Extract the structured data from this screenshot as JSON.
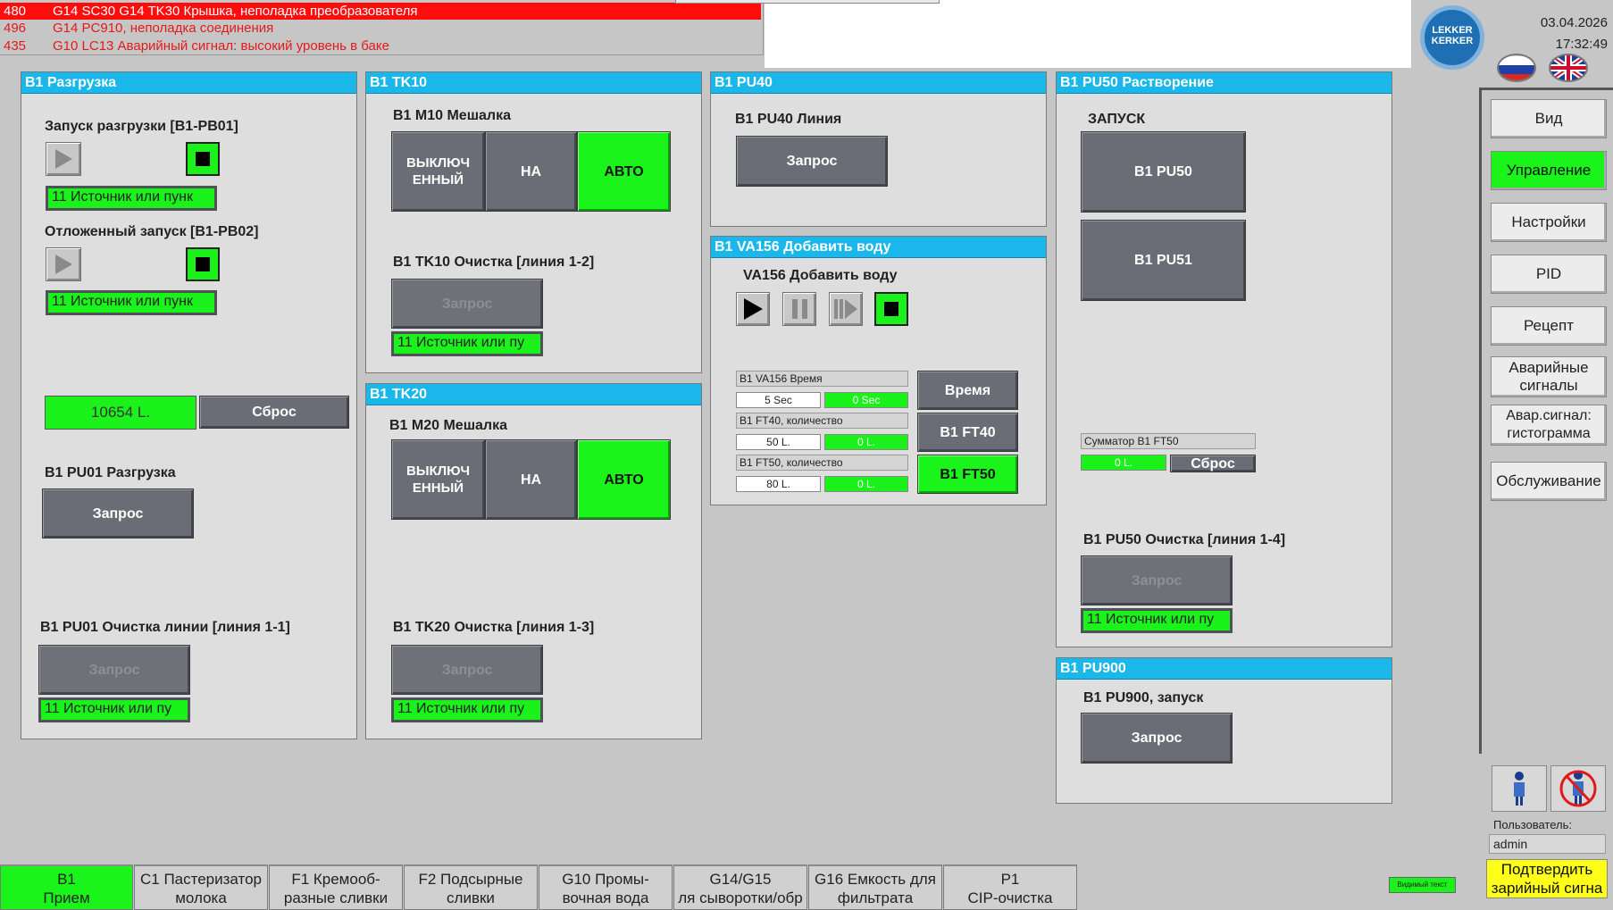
{
  "alarms": [
    {
      "num": "480",
      "text": "G14 SC30 G14 TK30 Крышка, неполадка преобразователя"
    },
    {
      "num": "496",
      "text": "G14 PC910, неполадка соединения"
    },
    {
      "num": "435",
      "text": "G10 LC13 Аварийный сигнал: высокий уровень в баке"
    }
  ],
  "header": {
    "logo_line1": "LEKKER",
    "logo_line2": "KERKER",
    "date": "03.04.2026",
    "time": "17:32:49"
  },
  "unload": {
    "title": "B1 Разгрузка",
    "start_label": "Запуск разгрузки [B1-PB01]",
    "start_status": "11 Источник или пунк",
    "delayed_label": "Отложенный запуск [B1-PB02]",
    "delayed_status": "11 Источник или пунк",
    "counter": "10654 L.",
    "reset": "Сброс",
    "pu01_label": "B1 PU01 Разгрузка",
    "pu01_btn": "Запрос",
    "clean_label": "B1 PU01 Очистка линии [линия 1-1]",
    "clean_btn": "Запрос",
    "clean_status": "11 Источник или пу"
  },
  "tk10": {
    "title": "B1 TK10",
    "mixer_label": "B1 M10 Мешалка",
    "mode_off": "ВЫКЛЮЧ ЕННЫЙ",
    "mode_on": "НА",
    "mode_auto": "АВТО",
    "clean_label": "B1 TK10 Очистка [линия 1-2]",
    "clean_btn": "Запрос",
    "clean_status": "11 Источник или пу"
  },
  "tk20": {
    "title": "B1 TK20",
    "mixer_label": "B1 M20 Мешалка",
    "mode_off": "ВЫКЛЮЧ ЕННЫЙ",
    "mode_on": "НА",
    "mode_auto": "АВТО",
    "clean_label": "B1 TK20 Очистка [линия 1-3]",
    "clean_btn": "Запрос",
    "clean_status": "11 Источник или пу"
  },
  "pu40": {
    "title": "B1 PU40",
    "line_label": "B1 PU40 Линия",
    "btn": "Запрос"
  },
  "va156": {
    "title": "B1 VA156 Добавить воду",
    "label": "VA156 Добавить воду",
    "time_label": "B1 VA156 Время",
    "time_set": "5 Sec",
    "time_act": "0 Sec",
    "time_btn": "Время",
    "ft40_label": "B1 FT40, количество",
    "ft40_set": "50 L.",
    "ft40_act": "0 L.",
    "ft40_btn": "B1 FT40",
    "ft50_label": "B1 FT50, количество",
    "ft50_set": "80 L.",
    "ft50_act": "0 L.",
    "ft50_btn": "B1 FT50"
  },
  "pu50": {
    "title": "B1 PU50 Растворение",
    "start_label": "ЗАПУСК",
    "pu50_btn": "B1 PU50",
    "pu51_btn": "B1 PU51",
    "totalizer_label": "Сумматор B1 FT50",
    "totalizer_value": "0 L.",
    "reset": "Сброс",
    "clean_label": "B1 PU50 Очистка [линия 1-4]",
    "clean_btn": "Запрос",
    "clean_status": "11 Источник или пу"
  },
  "pu900": {
    "title": "B1 PU900",
    "label": "B1 PU900, запуск",
    "btn": "Запрос"
  },
  "nav": {
    "items": [
      "Вид",
      "Управление",
      "Настройки",
      "PID",
      "Рецепт",
      "Аварийные сигналы",
      "Авар.сигнал: гистограмма",
      "Обслуживание"
    ],
    "active_index": 1,
    "user_label": "Пользователь:",
    "user_value": "admin",
    "ack_btn": "Подтвердить зарийный сигна"
  },
  "bottom_tabs": [
    {
      "line1": "B1",
      "line2": "Прием"
    },
    {
      "line1": "C1 Пастеризатор",
      "line2": "молока"
    },
    {
      "line1": "F1 Кремооб-",
      "line2": "разные сливки"
    },
    {
      "line1": "F2 Подсырные",
      "line2": "сливки"
    },
    {
      "line1": "G10 Промы-",
      "line2": "вочная вода"
    },
    {
      "line1": "G14/G15",
      "line2": "ля сыворотки/обр"
    },
    {
      "line1": "G16 Емкость для",
      "line2": "фильтрата"
    },
    {
      "line1": "P1",
      "line2": "CIP-очистка"
    }
  ],
  "visible_text_badge": "Видимый текст",
  "colors": {
    "header": "#1ab7ea",
    "active": "#1bf41b",
    "alarm": "#ff0d0d",
    "button": "#6b6d76"
  }
}
